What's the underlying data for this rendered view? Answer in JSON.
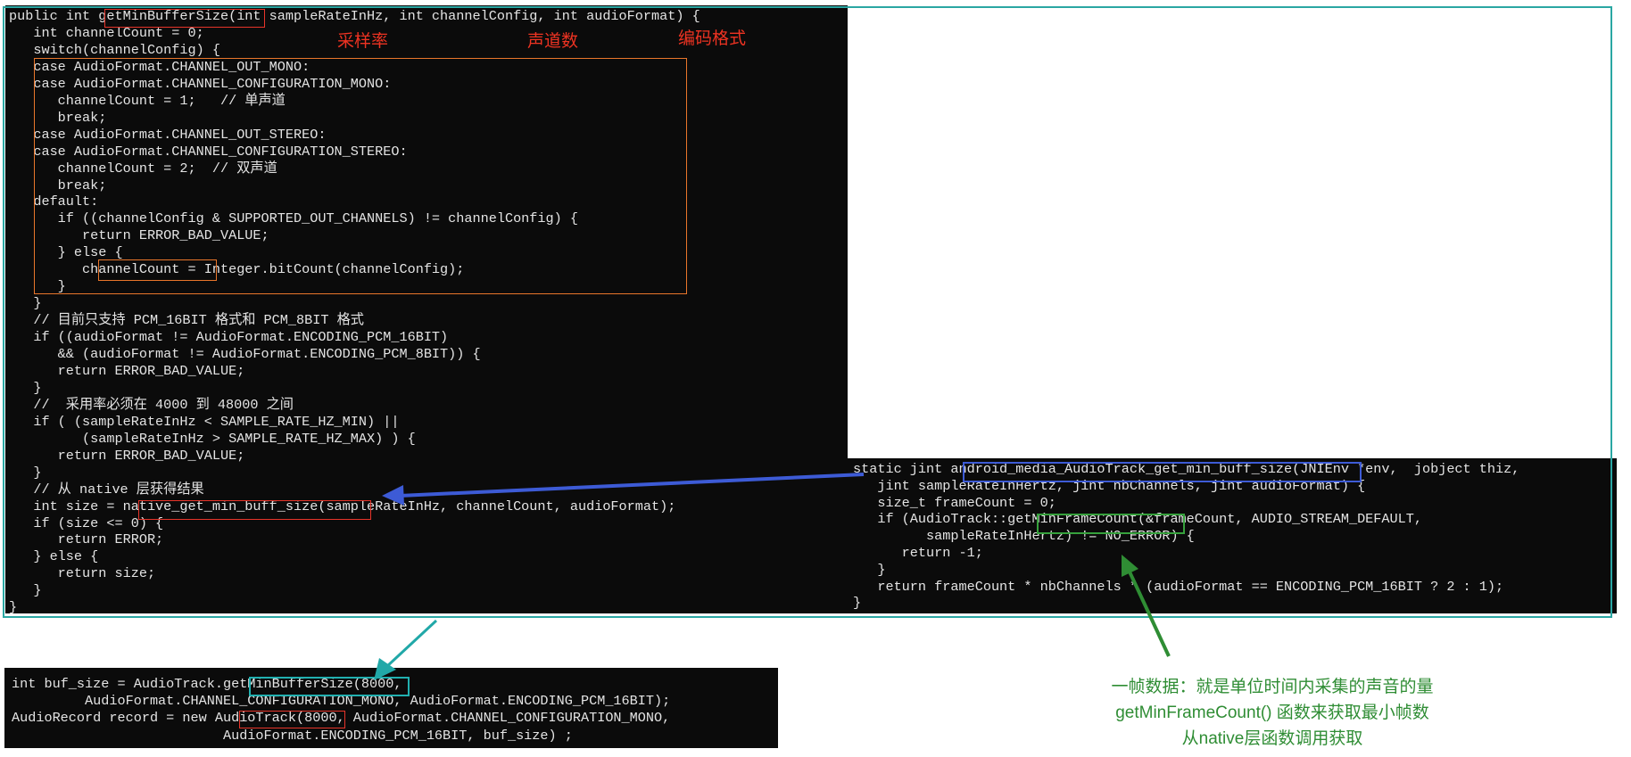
{
  "java_code": [
    "public int getMinBufferSize(int sampleRateInHz, int channelConfig, int audioFormat) {",
    "   int channelCount = 0;",
    "   switch(channelConfig) {",
    "   case AudioFormat.CHANNEL_OUT_MONO:",
    "   case AudioFormat.CHANNEL_CONFIGURATION_MONO:",
    "      channelCount = 1;   // 单声道",
    "      break;",
    "   case AudioFormat.CHANNEL_OUT_STEREO:",
    "   case AudioFormat.CHANNEL_CONFIGURATION_STEREO:",
    "      channelCount = 2;  // 双声道",
    "      break;",
    "   default:",
    "      if ((channelConfig & SUPPORTED_OUT_CHANNELS) != channelConfig) {",
    "         return ERROR_BAD_VALUE;",
    "      } else {",
    "         channelCount = Integer.bitCount(channelConfig);",
    "      }",
    "   }",
    "   // 目前只支持 PCM_16BIT 格式和 PCM_8BIT 格式",
    "   if ((audioFormat != AudioFormat.ENCODING_PCM_16BIT)",
    "      && (audioFormat != AudioFormat.ENCODING_PCM_8BIT)) {",
    "      return ERROR_BAD_VALUE;",
    "   }",
    "   //  采用率必须在 4000 到 48000 之间",
    "   if ( (sampleRateInHz < SAMPLE_RATE_HZ_MIN) ||",
    "         (sampleRateInHz > SAMPLE_RATE_HZ_MAX) ) {",
    "      return ERROR_BAD_VALUE;",
    "   }",
    "   // 从 native 层获得结果",
    "   int size = native_get_min_buff_size(sampleRateInHz, channelCount, audioFormat);",
    "   if (size <= 0) {",
    "      return ERROR;",
    "   } else {",
    "      return size;",
    "   }",
    "}"
  ],
  "native_code": [
    "static jint android_media_AudioTrack_get_min_buff_size(JNIEnv *env,  jobject thiz,",
    "   jint sampleRateInHertz, jint nbChannels, jint audioFormat) {",
    "   size_t frameCount = 0;",
    "   if (AudioTrack::getMinFrameCount(&frameCount, AUDIO_STREAM_DEFAULT,",
    "         sampleRateInHertz) != NO_ERROR) {",
    "      return -1;",
    "   }",
    "   return frameCount * nbChannels * (audioFormat == ENCODING_PCM_16BIT ? 2 : 1);",
    "}"
  ],
  "usage_code": [
    "int buf_size = AudioTrack.getMinBufferSize(8000,",
    "         AudioFormat.CHANNEL_CONFIGURATION_MONO, AudioFormat.ENCODING_PCM_16BIT);",
    "AudioRecord record = new AudioTrack(8000, AudioFormat.CHANNEL_CONFIGURATION_MONO,",
    "                          AudioFormat.ENCODING_PCM_16BIT, buf_size) ;"
  ],
  "annotations": {
    "sample_rate": "采样率",
    "channel_count": "声道数",
    "encoding_format": "编码格式"
  },
  "note": {
    "line1": "一帧数据：就是单位时间内采集的声音的量",
    "line2": "getMinFrameCount() 函数来获取最小帧数",
    "line3": "从native层函数调用获取"
  },
  "colors": {
    "code_background": "#0b0b0b",
    "code_text": "#e4e4e4",
    "frame_teal": "#2aa7a3",
    "highlight_red": "#e8352a",
    "highlight_orange": "#e9762b",
    "highlight_blue": "#3d5bd6",
    "highlight_green": "#36a13c",
    "highlight_teal": "#21b0b0",
    "arrow_blue": "#3d5bd6",
    "arrow_green": "#2f8d34",
    "arrow_teal": "#21a8a8",
    "annotation_red": "#ee3322",
    "note_green": "#2f8d34"
  }
}
